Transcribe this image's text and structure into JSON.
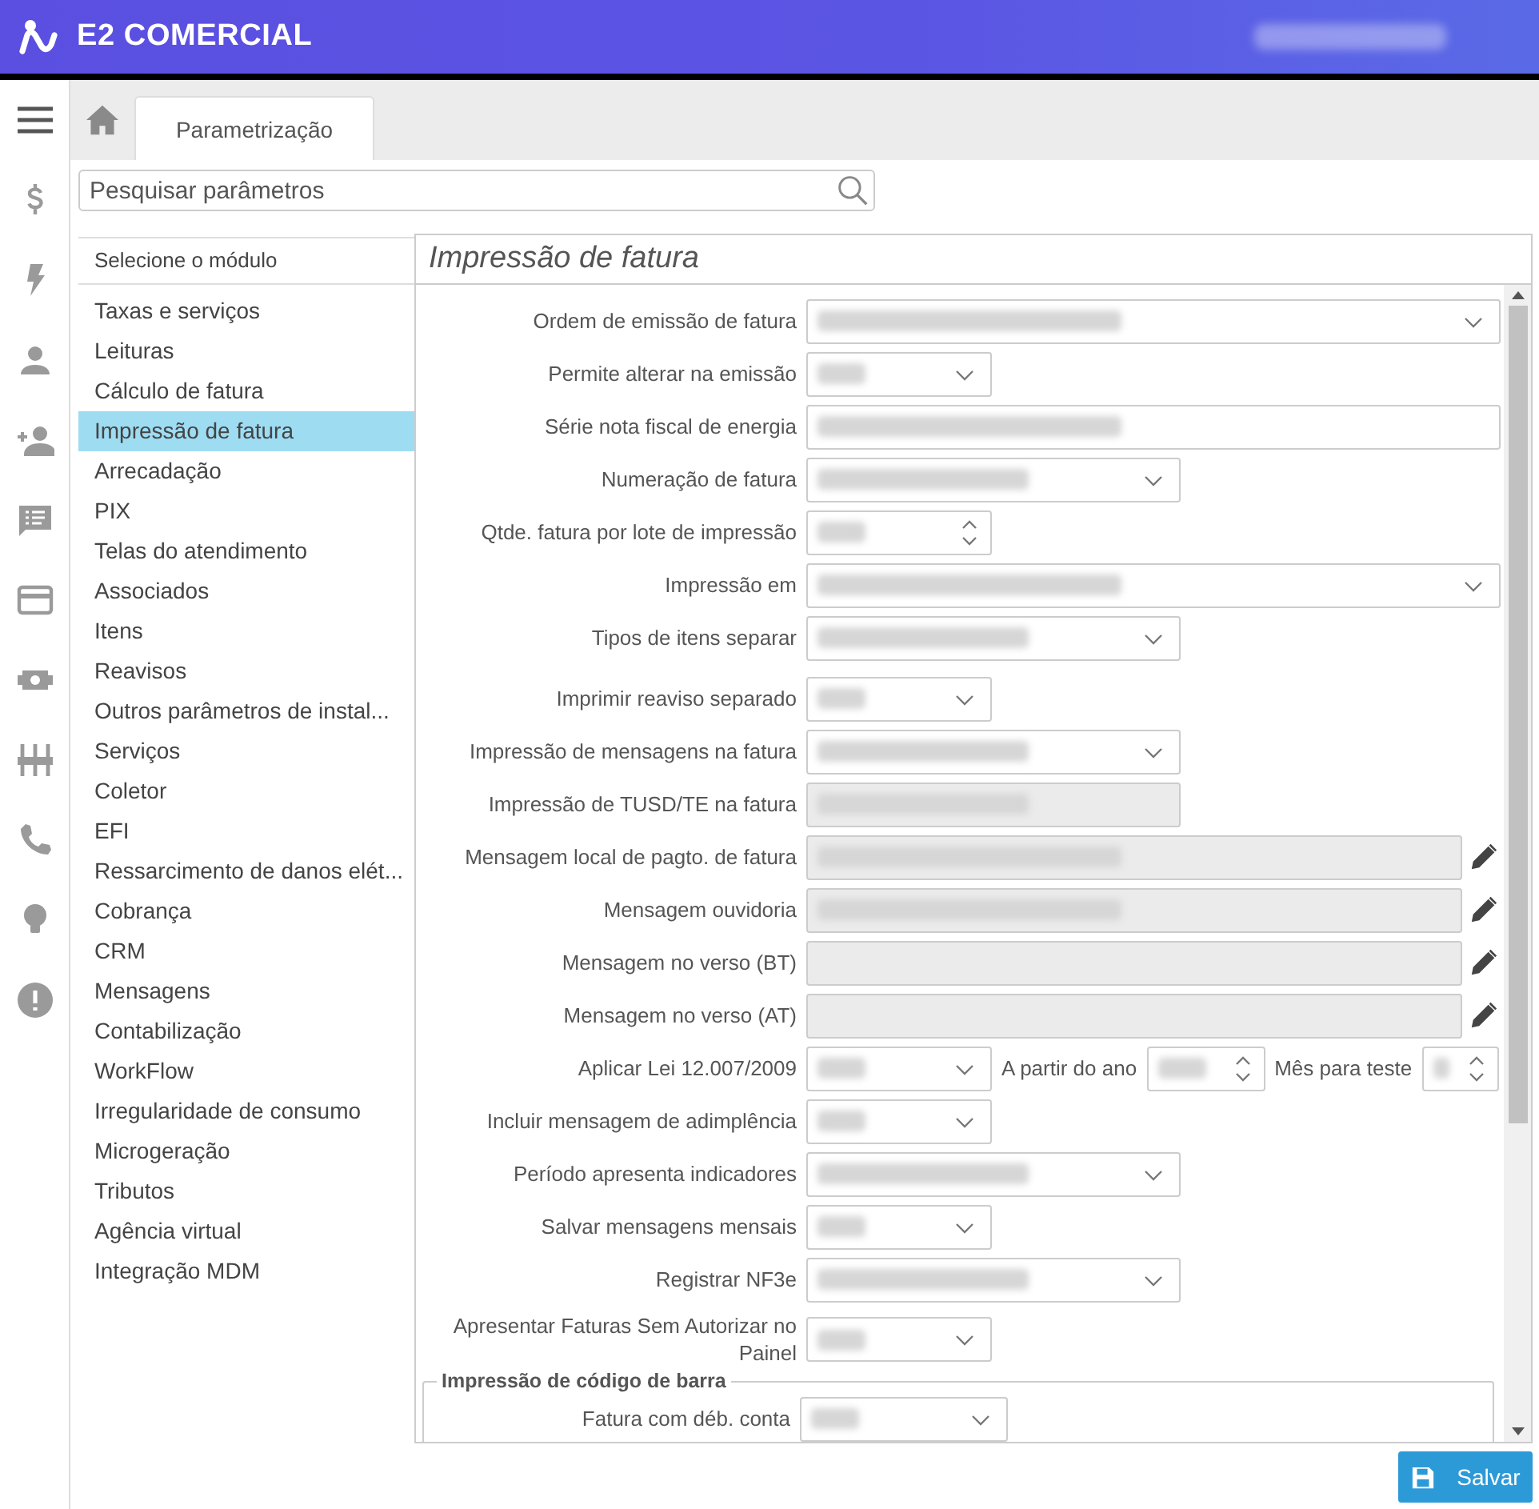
{
  "header": {
    "logo_text": "E2 COMERCIAL",
    "user_obscured": true
  },
  "tabs": [
    {
      "label": "Parametrização",
      "selected": true
    }
  ],
  "search": {
    "placeholder": "Pesquisar parâmetros"
  },
  "modules": {
    "heading": "Selecione o módulo",
    "items": [
      {
        "label": "Taxas e serviços",
        "selected": false
      },
      {
        "label": "Leituras",
        "selected": false
      },
      {
        "label": "Cálculo de fatura",
        "selected": false
      },
      {
        "label": "Impressão de fatura",
        "selected": true
      },
      {
        "label": "Arrecadação",
        "selected": false
      },
      {
        "label": "PIX",
        "selected": false
      },
      {
        "label": "Telas do atendimento",
        "selected": false
      },
      {
        "label": "Associados",
        "selected": false
      },
      {
        "label": "Itens",
        "selected": false
      },
      {
        "label": "Reavisos",
        "selected": false
      },
      {
        "label": "Outros parâmetros de instal...",
        "selected": false
      },
      {
        "label": "Serviços",
        "selected": false
      },
      {
        "label": "Coletor",
        "selected": false
      },
      {
        "label": "EFI",
        "selected": false
      },
      {
        "label": "Ressarcimento de danos elét...",
        "selected": false
      },
      {
        "label": "Cobrança",
        "selected": false
      },
      {
        "label": "CRM",
        "selected": false
      },
      {
        "label": "Mensagens",
        "selected": false
      },
      {
        "label": "Contabilização",
        "selected": false
      },
      {
        "label": "WorkFlow",
        "selected": false
      },
      {
        "label": "Irregularidade de consumo",
        "selected": false
      },
      {
        "label": "Microgeração",
        "selected": false
      },
      {
        "label": "Tributos",
        "selected": false
      },
      {
        "label": "Agência virtual",
        "selected": false
      },
      {
        "label": "Integração MDM",
        "selected": false
      }
    ]
  },
  "form": {
    "title": "Impressão de fatura",
    "rows": [
      {
        "label": "Ordem de emissão de fatura",
        "field": {
          "kind": "select",
          "wide": true,
          "short": false,
          "obscured": true
        }
      },
      {
        "label": "Permite alterar na emissão",
        "field": {
          "kind": "select",
          "wide": false,
          "short": true,
          "obscured": true
        }
      },
      {
        "label": "Série nota fiscal de energia",
        "field": {
          "kind": "text",
          "wide": true,
          "short": false,
          "obscured": true
        }
      },
      {
        "label": "Numeração de fatura",
        "field": {
          "kind": "select",
          "wide": false,
          "short": false,
          "obscured": true
        }
      },
      {
        "label": "Qtde. fatura por lote de impressão",
        "field": {
          "kind": "number",
          "wide": false,
          "short": true,
          "obscured": true
        }
      },
      {
        "label": "Impressão em",
        "field": {
          "kind": "select",
          "wide": true,
          "short": false,
          "obscured": true
        }
      },
      {
        "label": "Tipos de itens separar",
        "field": {
          "kind": "select",
          "wide": false,
          "short": false,
          "obscured": true
        }
      },
      {
        "label": "Imprimir reaviso separado",
        "field": {
          "kind": "select",
          "wide": false,
          "short": true,
          "obscured": true
        }
      },
      {
        "label": "Impressão de mensagens na fatura",
        "field": {
          "kind": "select",
          "wide": false,
          "short": false,
          "obscured": true
        }
      },
      {
        "label": "Impressão de TUSD/TE na fatura",
        "field": {
          "kind": "readonly",
          "wide": false,
          "short": false,
          "obscured": true
        }
      },
      {
        "label": "Mensagem local de pagto. de fatura",
        "field": {
          "kind": "readonly",
          "wide": true,
          "short": false,
          "obscured": true,
          "editable": true
        }
      },
      {
        "label": "Mensagem ouvidoria",
        "field": {
          "kind": "readonly",
          "wide": true,
          "short": false,
          "obscured": true,
          "editable": true
        }
      },
      {
        "label": "Mensagem no verso (BT)",
        "field": {
          "kind": "readonly",
          "wide": true,
          "short": false,
          "obscured": false,
          "editable": true
        }
      },
      {
        "label": "Mensagem no verso (AT)",
        "field": {
          "kind": "readonly",
          "wide": true,
          "short": false,
          "obscured": false,
          "editable": true
        }
      },
      {
        "label": "Aplicar Lei 12.007/2009",
        "field": {
          "kind": "select",
          "wide": false,
          "short": true,
          "obscured": true
        },
        "extras": [
          {
            "label": "A partir do ano",
            "field": {
              "kind": "number",
              "obscured": true
            }
          },
          {
            "label": "Mês para teste",
            "field": {
              "kind": "number",
              "obscured": true
            }
          }
        ]
      },
      {
        "label": "Incluir mensagem de adimplência",
        "field": {
          "kind": "select",
          "wide": false,
          "short": true,
          "obscured": true
        }
      },
      {
        "label": "Período apresenta indicadores",
        "field": {
          "kind": "select",
          "wide": false,
          "short": false,
          "obscured": true
        }
      },
      {
        "label": "Salvar mensagens mensais",
        "field": {
          "kind": "select",
          "wide": false,
          "short": true,
          "obscured": true
        }
      },
      {
        "label": "Registrar NF3e",
        "field": {
          "kind": "select",
          "wide": false,
          "short": false,
          "obscured": true
        }
      },
      {
        "label": "Apresentar Faturas Sem Autorizar no Painel",
        "field": {
          "kind": "select",
          "wide": false,
          "short": true,
          "obscured": true
        }
      }
    ],
    "group": {
      "legend": "Impressão de código de barra",
      "rows": [
        {
          "label": "Fatura com déb. conta",
          "field": {
            "kind": "select",
            "wide": false,
            "short": true,
            "obscured": true
          }
        }
      ]
    }
  },
  "save_button": {
    "label": "Salvar"
  }
}
